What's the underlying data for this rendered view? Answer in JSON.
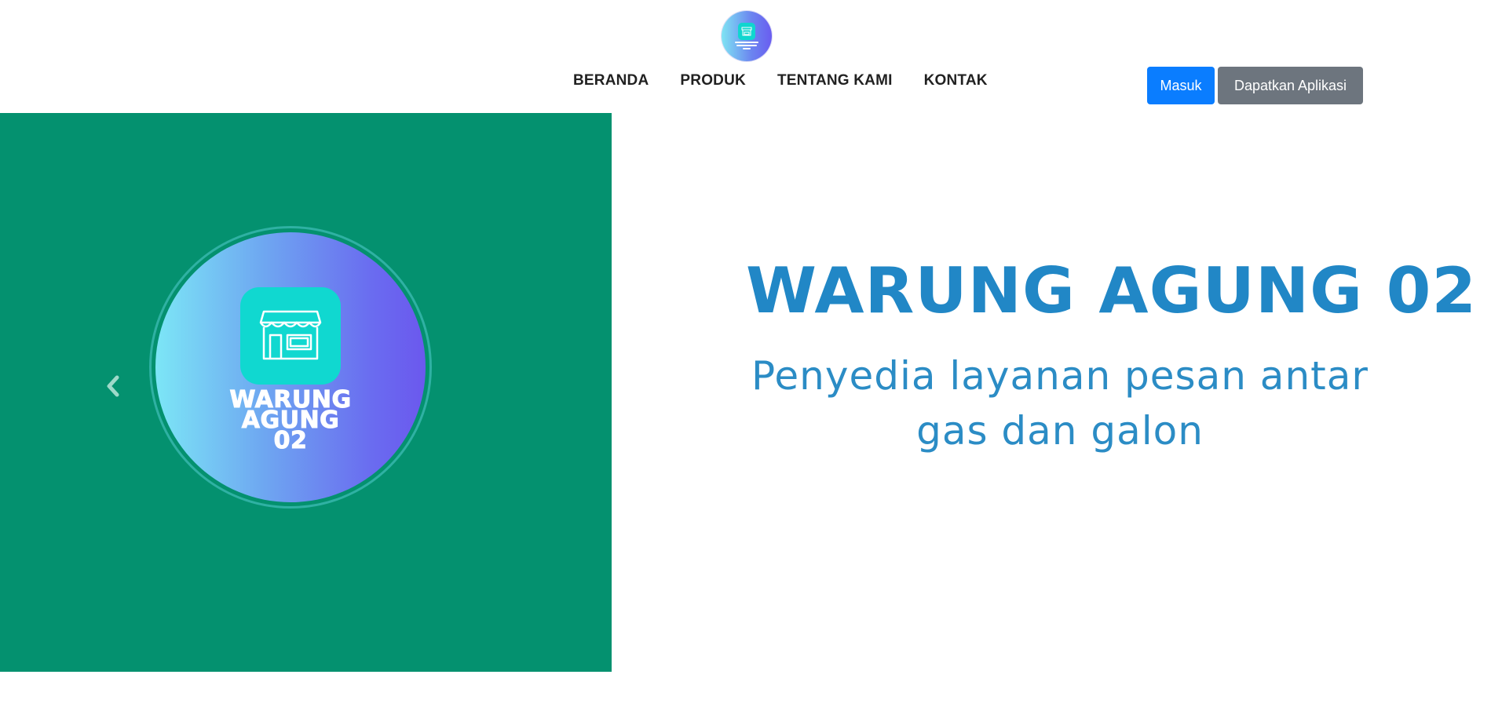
{
  "header": {
    "logo_icon": "store-logo-icon",
    "nav": {
      "home": "BERANDA",
      "products": "PRODUK",
      "about": "TENTANG KAMI",
      "contact": "KONTAK"
    },
    "buttons": {
      "login": "Masuk",
      "get_app": "Dapatkan Aplikasi"
    },
    "colors": {
      "login_bg": "#0a7dff",
      "get_app_bg": "#6d757e"
    }
  },
  "hero": {
    "background_left": "#04916f",
    "logo_text": [
      "WARUNG",
      "AGUNG",
      "02"
    ],
    "title": "WARUNG AGUNG 02",
    "subtitle_line1": "Penyedia layanan pesan antar",
    "subtitle_line2": "gas dan galon",
    "title_color": "#2187c6",
    "prev_icon": "chevron-left-icon"
  }
}
